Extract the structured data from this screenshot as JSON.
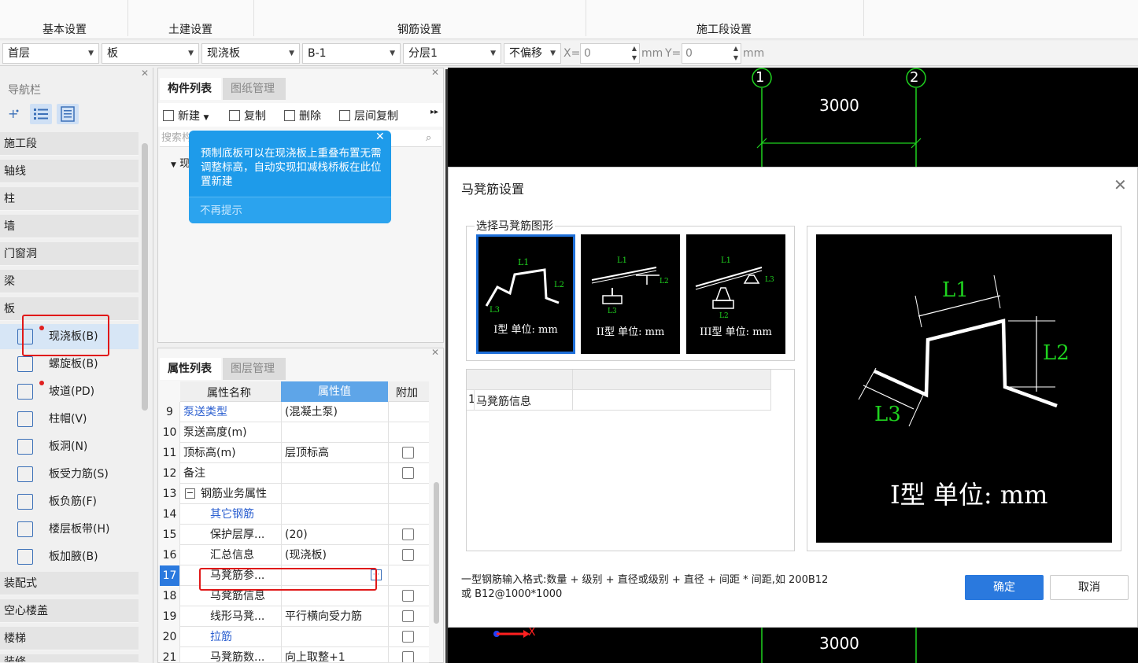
{
  "ribbon": {
    "tabs": [
      "基本设置",
      "土建设置",
      "钢筋设置",
      "施工段设置"
    ]
  },
  "selector": {
    "floor": "首层",
    "category": "板",
    "type": "现浇板",
    "component": "B-1",
    "layer": "分层1",
    "offset": "不偏移",
    "x_label": "X=",
    "x_value": "0",
    "unit1": "mm",
    "y_label": "Y=",
    "y_value": "0",
    "unit2": "mm"
  },
  "nav": {
    "title": "导航栏",
    "categories_top": [
      "施工段",
      "轴线",
      "柱",
      "墙",
      "门窗洞",
      "梁",
      "板"
    ],
    "items": [
      "现浇板(B)",
      "螺旋板(B)",
      "坡道(PD)",
      "柱帽(V)",
      "板洞(N)",
      "板受力筋(S)",
      "板负筋(F)",
      "楼层板带(H)",
      "板加腋(B)"
    ],
    "categories_bottom": [
      "装配式",
      "空心楼盖",
      "楼梯",
      "装修"
    ]
  },
  "comp": {
    "tab_active": "构件列表",
    "tab_inactive": "图纸管理",
    "new": "新建",
    "copy": "复制",
    "delete": "删除",
    "floor_copy": "层间复制",
    "search": "搜索构",
    "tree_item": "现",
    "tooltip_text": "预制底板可以在现浇板上重叠布置无需调整标高，自动实现扣减栈桥板在此位置新建",
    "tooltip_dismiss": "不再提示"
  },
  "props": {
    "tab_active": "属性列表",
    "tab_inactive": "图层管理",
    "col_name": "属性名称",
    "col_value": "属性值",
    "col_add": "附加",
    "rows": [
      {
        "num": "9",
        "name": "泵送类型",
        "value": "(混凝土泵)"
      },
      {
        "num": "10",
        "name": "泵送高度(m)",
        "value": ""
      },
      {
        "num": "11",
        "name": "顶标高(m)",
        "value": "层顶标高"
      },
      {
        "num": "12",
        "name": "备注",
        "value": ""
      },
      {
        "num": "13",
        "name": "钢筋业务属性",
        "value": ""
      },
      {
        "num": "14",
        "name": "其它钢筋",
        "value": ""
      },
      {
        "num": "15",
        "name": "保护层厚...",
        "value": "(20)"
      },
      {
        "num": "16",
        "name": "汇总信息",
        "value": "(现浇板)"
      },
      {
        "num": "17",
        "name": "马凳筋参...",
        "value": ""
      },
      {
        "num": "18",
        "name": "马凳筋信息",
        "value": ""
      },
      {
        "num": "19",
        "name": "线形马凳...",
        "value": "平行横向受力筋"
      },
      {
        "num": "20",
        "name": "拉筋",
        "value": ""
      },
      {
        "num": "21",
        "name": "马凳筋数...",
        "value": "向上取整+1"
      }
    ]
  },
  "canvas": {
    "axis1": "1",
    "axis2": "2",
    "dim_top": "3000",
    "dim_bottom": "3000",
    "axis_x": "X"
  },
  "dialog": {
    "title": "马凳筋设置",
    "group_label": "选择马凳筋图形",
    "thumb1": "I型 单位: mm",
    "thumb2": "II型 单位: mm",
    "thumb3": "III型 单位: mm",
    "table_row_num": "1",
    "table_row_name": "马凳筋信息",
    "preview_label": "I型 单位: mm",
    "l1": "L1",
    "l2": "L2",
    "l3": "L3",
    "hint_line1": "一型钢筋输入格式:数量 + 级别 + 直径或级别 + 直径 + 间距 * 间距,如 200B12",
    "hint_line2": "或 B12@1000*1000",
    "ok": "确定",
    "cancel": "取消"
  },
  "colors": {
    "accent": "#2a79de",
    "tooltip": "#1e9bea",
    "highlight": "#e01818",
    "cad_green": "#1fd31f"
  }
}
